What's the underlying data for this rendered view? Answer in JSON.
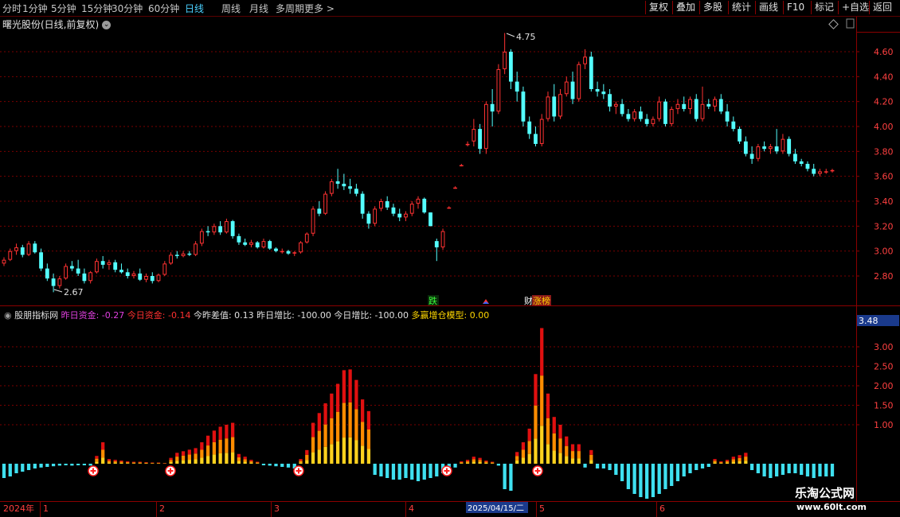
{
  "toolbar": {
    "periods": [
      "分时",
      "1分钟",
      "5分钟",
      "15分钟",
      "30分钟",
      "60分钟",
      "日线",
      "周线",
      "月线",
      "多周期",
      "更多 >"
    ],
    "active_period": "日线",
    "right_buttons": [
      "复权",
      "叠加",
      "多股",
      "统计",
      "画线",
      "F10",
      "标记",
      "+自选",
      "返回"
    ]
  },
  "title": "曙光股份(日线,前复权)",
  "price_axis": [
    "4.60",
    "4.40",
    "4.20",
    "4.00",
    "3.80",
    "3.60",
    "3.40",
    "3.20",
    "3.00",
    "2.80"
  ],
  "price_high_label": "4.75",
  "price_low_label": "2.67",
  "markers": {
    "die": "跌",
    "bang": "涨榜",
    "bang_prefix": "财"
  },
  "indicator": {
    "name": "股朋指标网",
    "items": [
      {
        "label": "昨日资金:",
        "value": "-0.27",
        "color": "#e040e0"
      },
      {
        "label": "今日资金:",
        "value": "-0.14",
        "color": "#ff3030"
      },
      {
        "label": "今昨差值:",
        "value": "0.13",
        "color": "#e0e0e0"
      },
      {
        "label": "昨日增比:",
        "value": "-100.00",
        "color": "#e0e0e0"
      },
      {
        "label": "今日增比:",
        "value": "-100.00",
        "color": "#e0e0e0"
      },
      {
        "label": "多赢增仓模型:",
        "value": "0.00",
        "color": "#ffd700"
      }
    ],
    "axis": [
      "3.00",
      "2.50",
      "2.00",
      "1.50",
      "1.00"
    ],
    "current_value": "3.48"
  },
  "time_axis": {
    "year": "2024年",
    "months": [
      "1",
      "2",
      "3",
      "4",
      "5",
      "6"
    ],
    "cursor_date": "2025/04/15/二"
  },
  "watermark": {
    "line1": "乐淘公式网",
    "line2": "www.60lt.com"
  },
  "colors": {
    "up": "#ff3232",
    "down": "#54ffff",
    "grid": "#7a0000",
    "border": "#8b0000"
  },
  "chart_data": {
    "type": "candlestick",
    "price_range": [
      2.62,
      4.78
    ],
    "candles_estimated": [
      [
        2.9,
        2.95,
        2.88,
        2.93
      ],
      [
        2.93,
        3.02,
        2.92,
        3.0
      ],
      [
        3.0,
        3.06,
        2.97,
        3.03
      ],
      [
        3.03,
        3.05,
        2.95,
        2.97
      ],
      [
        2.97,
        3.08,
        2.96,
        3.06
      ],
      [
        3.06,
        3.08,
        2.98,
        2.99
      ],
      [
        2.99,
        3.02,
        2.84,
        2.86
      ],
      [
        2.86,
        2.9,
        2.76,
        2.78
      ],
      [
        2.78,
        2.82,
        2.67,
        2.72
      ],
      [
        2.72,
        2.8,
        2.7,
        2.78
      ],
      [
        2.78,
        2.9,
        2.77,
        2.88
      ],
      [
        2.88,
        2.92,
        2.84,
        2.86
      ],
      [
        2.86,
        2.93,
        2.8,
        2.82
      ],
      [
        2.82,
        2.86,
        2.74,
        2.76
      ],
      [
        2.76,
        2.84,
        2.74,
        2.83
      ],
      [
        2.83,
        2.94,
        2.82,
        2.92
      ],
      [
        2.92,
        2.96,
        2.86,
        2.89
      ],
      [
        2.89,
        2.93,
        2.85,
        2.91
      ],
      [
        2.91,
        2.93,
        2.83,
        2.85
      ],
      [
        2.85,
        2.9,
        2.82,
        2.83
      ],
      [
        2.83,
        2.86,
        2.78,
        2.8
      ],
      [
        2.8,
        2.84,
        2.78,
        2.82
      ],
      [
        2.82,
        2.86,
        2.76,
        2.77
      ],
      [
        2.77,
        2.82,
        2.75,
        2.8
      ],
      [
        2.8,
        2.83,
        2.74,
        2.76
      ],
      [
        2.76,
        2.82,
        2.75,
        2.81
      ],
      [
        2.81,
        2.92,
        2.8,
        2.9
      ],
      [
        2.9,
        2.99,
        2.89,
        2.97
      ],
      [
        2.97,
        3.0,
        2.94,
        2.96
      ],
      [
        2.96,
        3.0,
        2.95,
        2.98
      ],
      [
        2.98,
        3.0,
        2.96,
        2.97
      ],
      [
        2.97,
        3.08,
        2.96,
        3.06
      ],
      [
        3.06,
        3.18,
        3.04,
        3.16
      ],
      [
        3.16,
        3.2,
        3.12,
        3.15
      ],
      [
        3.15,
        3.22,
        3.13,
        3.2
      ],
      [
        3.2,
        3.24,
        3.13,
        3.15
      ],
      [
        3.15,
        3.26,
        3.14,
        3.24
      ],
      [
        3.24,
        3.25,
        3.1,
        3.12
      ],
      [
        3.12,
        3.14,
        3.05,
        3.07
      ],
      [
        3.07,
        3.1,
        3.04,
        3.05
      ],
      [
        3.05,
        3.09,
        3.03,
        3.07
      ],
      [
        3.07,
        3.08,
        3.02,
        3.03
      ],
      [
        3.03,
        3.1,
        3.02,
        3.08
      ],
      [
        3.08,
        3.09,
        3.01,
        3.02
      ],
      [
        3.02,
        3.03,
        2.99,
        3.0
      ],
      [
        3.0,
        3.02,
        2.98,
        3.0
      ],
      [
        3.0,
        3.01,
        2.97,
        2.98
      ],
      [
        2.98,
        3.0,
        2.96,
        2.99
      ],
      [
        2.99,
        3.08,
        2.98,
        3.07
      ],
      [
        3.07,
        3.15,
        3.06,
        3.14
      ],
      [
        3.14,
        3.36,
        3.12,
        3.34
      ],
      [
        3.34,
        3.4,
        3.28,
        3.3
      ],
      [
        3.3,
        3.48,
        3.29,
        3.46
      ],
      [
        3.46,
        3.58,
        3.44,
        3.56
      ],
      [
        3.56,
        3.66,
        3.5,
        3.54
      ],
      [
        3.54,
        3.62,
        3.49,
        3.52
      ],
      [
        3.52,
        3.58,
        3.46,
        3.5
      ],
      [
        3.5,
        3.54,
        3.44,
        3.46
      ],
      [
        3.46,
        3.48,
        3.26,
        3.3
      ],
      [
        3.3,
        3.32,
        3.18,
        3.22
      ],
      [
        3.22,
        3.36,
        3.2,
        3.34
      ],
      [
        3.34,
        3.42,
        3.32,
        3.4
      ],
      [
        3.4,
        3.44,
        3.33,
        3.35
      ],
      [
        3.35,
        3.38,
        3.28,
        3.3
      ],
      [
        3.3,
        3.34,
        3.24,
        3.27
      ],
      [
        3.27,
        3.32,
        3.24,
        3.3
      ],
      [
        3.3,
        3.4,
        3.28,
        3.38
      ],
      [
        3.38,
        3.44,
        3.34,
        3.42
      ],
      [
        3.42,
        3.43,
        3.3,
        3.31
      ],
      [
        3.31,
        3.31,
        3.2,
        3.2
      ],
      [
        3.08,
        3.1,
        2.92,
        3.03
      ],
      [
        3.03,
        3.18,
        3.01,
        3.16
      ],
      [
        3.35,
        3.36,
        3.34,
        3.35
      ],
      [
        3.51,
        3.52,
        3.5,
        3.51
      ],
      [
        3.69,
        3.7,
        3.68,
        3.69
      ],
      [
        3.86,
        3.88,
        3.84,
        3.86
      ],
      [
        3.88,
        4.06,
        3.84,
        3.98
      ],
      [
        3.98,
        4.02,
        3.78,
        3.82
      ],
      [
        3.82,
        4.2,
        3.78,
        4.18
      ],
      [
        4.18,
        4.3,
        4.0,
        4.12
      ],
      [
        4.12,
        4.5,
        4.1,
        4.46
      ],
      [
        4.46,
        4.75,
        4.42,
        4.6
      ],
      [
        4.6,
        4.62,
        4.3,
        4.36
      ],
      [
        4.36,
        4.44,
        4.2,
        4.28
      ],
      [
        4.28,
        4.32,
        4.0,
        4.04
      ],
      [
        4.04,
        4.08,
        3.9,
        3.94
      ],
      [
        3.94,
        4.0,
        3.84,
        3.86
      ],
      [
        3.86,
        4.1,
        3.84,
        4.06
      ],
      [
        4.06,
        4.28,
        4.04,
        4.24
      ],
      [
        4.24,
        4.34,
        4.04,
        4.08
      ],
      [
        4.08,
        4.3,
        4.06,
        4.26
      ],
      [
        4.26,
        4.4,
        4.24,
        4.36
      ],
      [
        4.36,
        4.44,
        4.18,
        4.22
      ],
      [
        4.22,
        4.52,
        4.2,
        4.5
      ],
      [
        4.5,
        4.62,
        4.46,
        4.56
      ],
      [
        4.56,
        4.6,
        4.28,
        4.3
      ],
      [
        4.3,
        4.36,
        4.24,
        4.28
      ],
      [
        4.28,
        4.34,
        4.22,
        4.26
      ],
      [
        4.26,
        4.3,
        4.12,
        4.16
      ],
      [
        4.16,
        4.2,
        4.1,
        4.18
      ],
      [
        4.18,
        4.22,
        4.08,
        4.1
      ],
      [
        4.1,
        4.14,
        4.04,
        4.06
      ],
      [
        4.06,
        4.14,
        4.04,
        4.12
      ],
      [
        4.12,
        4.16,
        4.04,
        4.06
      ],
      [
        4.06,
        4.1,
        4.0,
        4.02
      ],
      [
        4.02,
        4.08,
        4.0,
        4.06
      ],
      [
        4.06,
        4.24,
        4.04,
        4.2
      ],
      [
        4.2,
        4.22,
        4.0,
        4.02
      ],
      [
        4.02,
        4.16,
        4.0,
        4.14
      ],
      [
        4.14,
        4.22,
        4.1,
        4.18
      ],
      [
        4.18,
        4.24,
        4.12,
        4.14
      ],
      [
        4.14,
        4.24,
        4.1,
        4.22
      ],
      [
        4.22,
        4.26,
        4.04,
        4.06
      ],
      [
        4.06,
        4.32,
        4.04,
        4.18
      ],
      [
        4.18,
        4.22,
        4.14,
        4.16
      ],
      [
        4.16,
        4.24,
        4.12,
        4.22
      ],
      [
        4.22,
        4.26,
        4.1,
        4.12
      ],
      [
        4.12,
        4.18,
        4.0,
        4.04
      ],
      [
        4.04,
        4.08,
        3.96,
        3.98
      ],
      [
        3.98,
        4.0,
        3.86,
        3.88
      ],
      [
        3.88,
        3.92,
        3.76,
        3.78
      ],
      [
        3.78,
        3.84,
        3.7,
        3.74
      ],
      [
        3.74,
        3.86,
        3.72,
        3.84
      ],
      [
        3.84,
        3.88,
        3.8,
        3.82
      ],
      [
        3.82,
        3.86,
        3.78,
        3.84
      ],
      [
        3.84,
        3.98,
        3.78,
        3.8
      ],
      [
        3.8,
        3.94,
        3.78,
        3.9
      ],
      [
        3.9,
        3.92,
        3.76,
        3.78
      ],
      [
        3.78,
        3.82,
        3.7,
        3.72
      ],
      [
        3.72,
        3.74,
        3.68,
        3.7
      ],
      [
        3.7,
        3.72,
        3.64,
        3.66
      ],
      [
        3.66,
        3.7,
        3.6,
        3.62
      ],
      [
        3.62,
        3.66,
        3.6,
        3.64
      ],
      [
        3.64,
        3.66,
        3.62,
        3.64
      ],
      [
        3.64,
        3.66,
        3.63,
        3.65
      ]
    ],
    "indicator_bars_estimated": [
      -0.45,
      -0.4,
      -0.3,
      -0.25,
      -0.2,
      -0.15,
      -0.12,
      -0.1,
      -0.08,
      -0.06,
      -0.05,
      -0.06,
      -0.05,
      -0.05,
      -0.06,
      0.2,
      0.55,
      0.12,
      0.1,
      0.08,
      0.06,
      0.05,
      0.05,
      0.04,
      0.03,
      0.03,
      0.02,
      0.15,
      0.28,
      0.32,
      0.36,
      0.4,
      0.55,
      0.72,
      0.85,
      0.95,
      1.0,
      1.05,
      0.25,
      0.18,
      0.1,
      0.05,
      -0.05,
      -0.06,
      -0.08,
      -0.1,
      -0.12,
      -0.15,
      0.12,
      0.35,
      1.05,
      1.3,
      1.55,
      1.8,
      2.05,
      2.4,
      2.42,
      2.15,
      1.65,
      1.35,
      -0.35,
      -0.4,
      -0.45,
      -0.5,
      -0.5,
      -0.45,
      -0.5,
      -0.55,
      -0.5,
      -0.45,
      -0.4,
      -0.3,
      -0.2,
      -0.12,
      0.06,
      0.1,
      0.18,
      0.15,
      0.08,
      0.05,
      -0.06,
      -0.8,
      -0.85,
      0.3,
      0.55,
      0.9,
      2.3,
      3.48,
      1.8,
      1.2,
      1.0,
      0.7,
      0.5,
      0.5,
      -0.12,
      0.35,
      -0.15,
      -0.15,
      -0.2,
      -0.35,
      -0.55,
      -0.8,
      -0.95,
      -1.05,
      -1.1,
      -1.05,
      -0.95,
      -0.8,
      -0.7,
      -0.55,
      -0.4,
      -0.3,
      -0.2,
      -0.15,
      -0.1,
      0.12,
      0.06,
      0.1,
      0.18,
      0.22,
      0.28,
      -0.2,
      -0.3,
      -0.4,
      -0.45,
      -0.4,
      -0.35,
      -0.3,
      -0.3,
      -0.35,
      -0.4,
      -0.45,
      -0.4,
      -0.4,
      -0.4
    ]
  }
}
